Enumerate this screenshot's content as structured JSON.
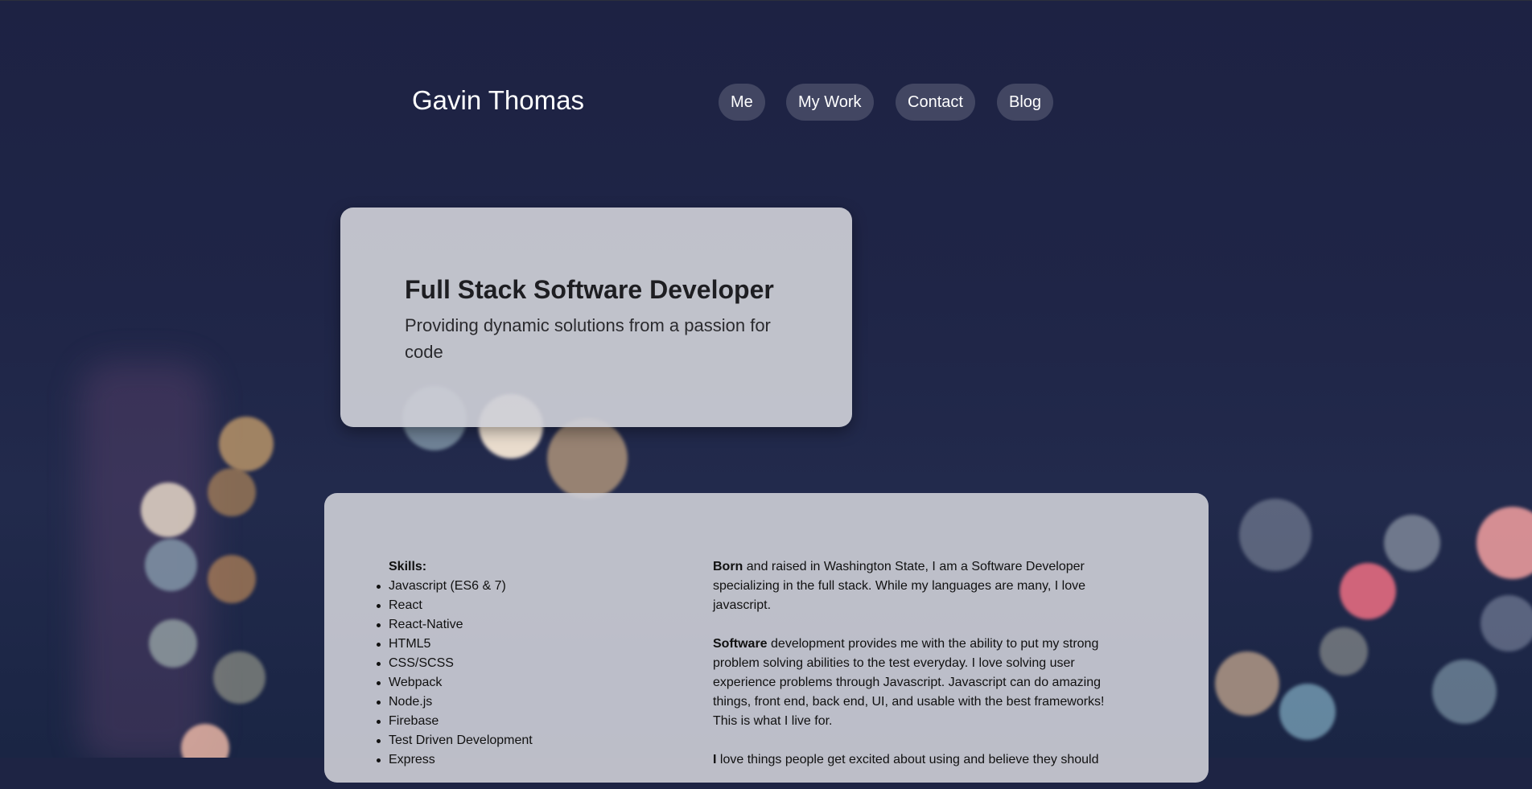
{
  "header": {
    "brand": "Gavin Thomas",
    "nav": [
      {
        "label": "Me"
      },
      {
        "label": "My Work"
      },
      {
        "label": "Contact"
      },
      {
        "label": "Blog"
      }
    ]
  },
  "hero": {
    "title": "Full Stack Software Developer",
    "subtitle": "Providing dynamic solutions from a passion for code"
  },
  "about": {
    "skills_title": "Skills:",
    "skills": [
      "Javascript (ES6 & 7)",
      "React",
      "React-Native",
      "HTML5",
      "CSS/SCSS",
      "Webpack",
      "Node.js",
      "Firebase",
      "Test Driven Development",
      "Express"
    ],
    "bio": [
      {
        "lead": "Born",
        "text": " and raised in Washington State, I am a Software Developer specializing in the full stack. While my languages are many, I love javascript."
      },
      {
        "lead": "Software",
        "text": " development provides me with the ability to put my strong problem solving abilities to the test everyday. I love solving user experience problems through Javascript. Javascript can do amazing things, front end, back end, UI, and usable with the best frameworks! This is what I live for."
      },
      {
        "lead": "I",
        "text": " love things people get excited about using and believe they should"
      }
    ]
  },
  "colors": {
    "background": "#1e2444",
    "card": "#cecfd7",
    "nav_pill": "#45485e",
    "text_dark": "#1e1e22"
  }
}
